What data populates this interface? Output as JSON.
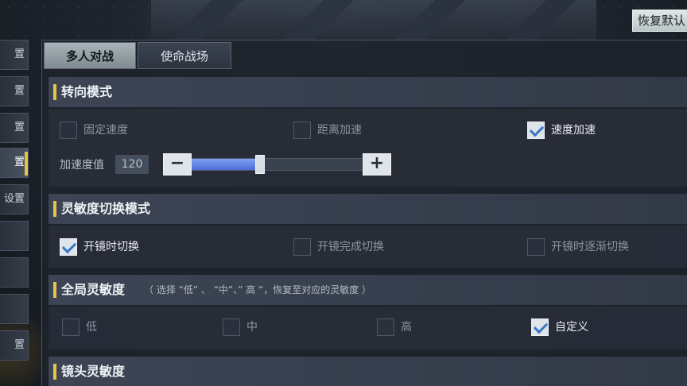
{
  "header": {
    "restore_label": "恢复默认"
  },
  "sidebar": {
    "items": [
      {
        "label": "置"
      },
      {
        "label": "置"
      },
      {
        "label": "置"
      },
      {
        "label": "置",
        "active": true
      },
      {
        "label": "设置"
      },
      {
        "label": ""
      },
      {
        "label": ""
      },
      {
        "label": ""
      },
      {
        "label": "置"
      }
    ]
  },
  "tabs": [
    {
      "label": "多人对战",
      "active": true
    },
    {
      "label": "使命战场",
      "active": false
    }
  ],
  "turn_mode": {
    "title": "转向模式",
    "options": [
      {
        "label": "固定速度",
        "checked": false
      },
      {
        "label": "距离加速",
        "checked": false
      },
      {
        "label": "速度加速",
        "checked": true
      }
    ],
    "accel_label": "加速度值",
    "accel_value": "120",
    "minus_label": "−",
    "plus_label": "+",
    "accel_fraction": 0.4
  },
  "sens_switch": {
    "title": "灵敏度切换模式",
    "options": [
      {
        "label": "开镜时切换",
        "checked": true
      },
      {
        "label": "开镜完成切换",
        "checked": false
      },
      {
        "label": "开镜时逐渐切换",
        "checked": false
      }
    ]
  },
  "global_sens": {
    "title": "全局灵敏度",
    "hint": "（ 选择 “低” 、 “中”、” 高 “，恢复至对应的灵敏度 ）",
    "options": [
      {
        "label": "低",
        "checked": false
      },
      {
        "label": "中",
        "checked": false
      },
      {
        "label": "高",
        "checked": false
      },
      {
        "label": "自定义",
        "checked": true
      }
    ]
  },
  "lens_sens": {
    "title": "镜头灵敏度"
  },
  "colors": {
    "accent": "#e6c34a",
    "check": "#3a76c8",
    "slider": "#5a7fe0"
  }
}
